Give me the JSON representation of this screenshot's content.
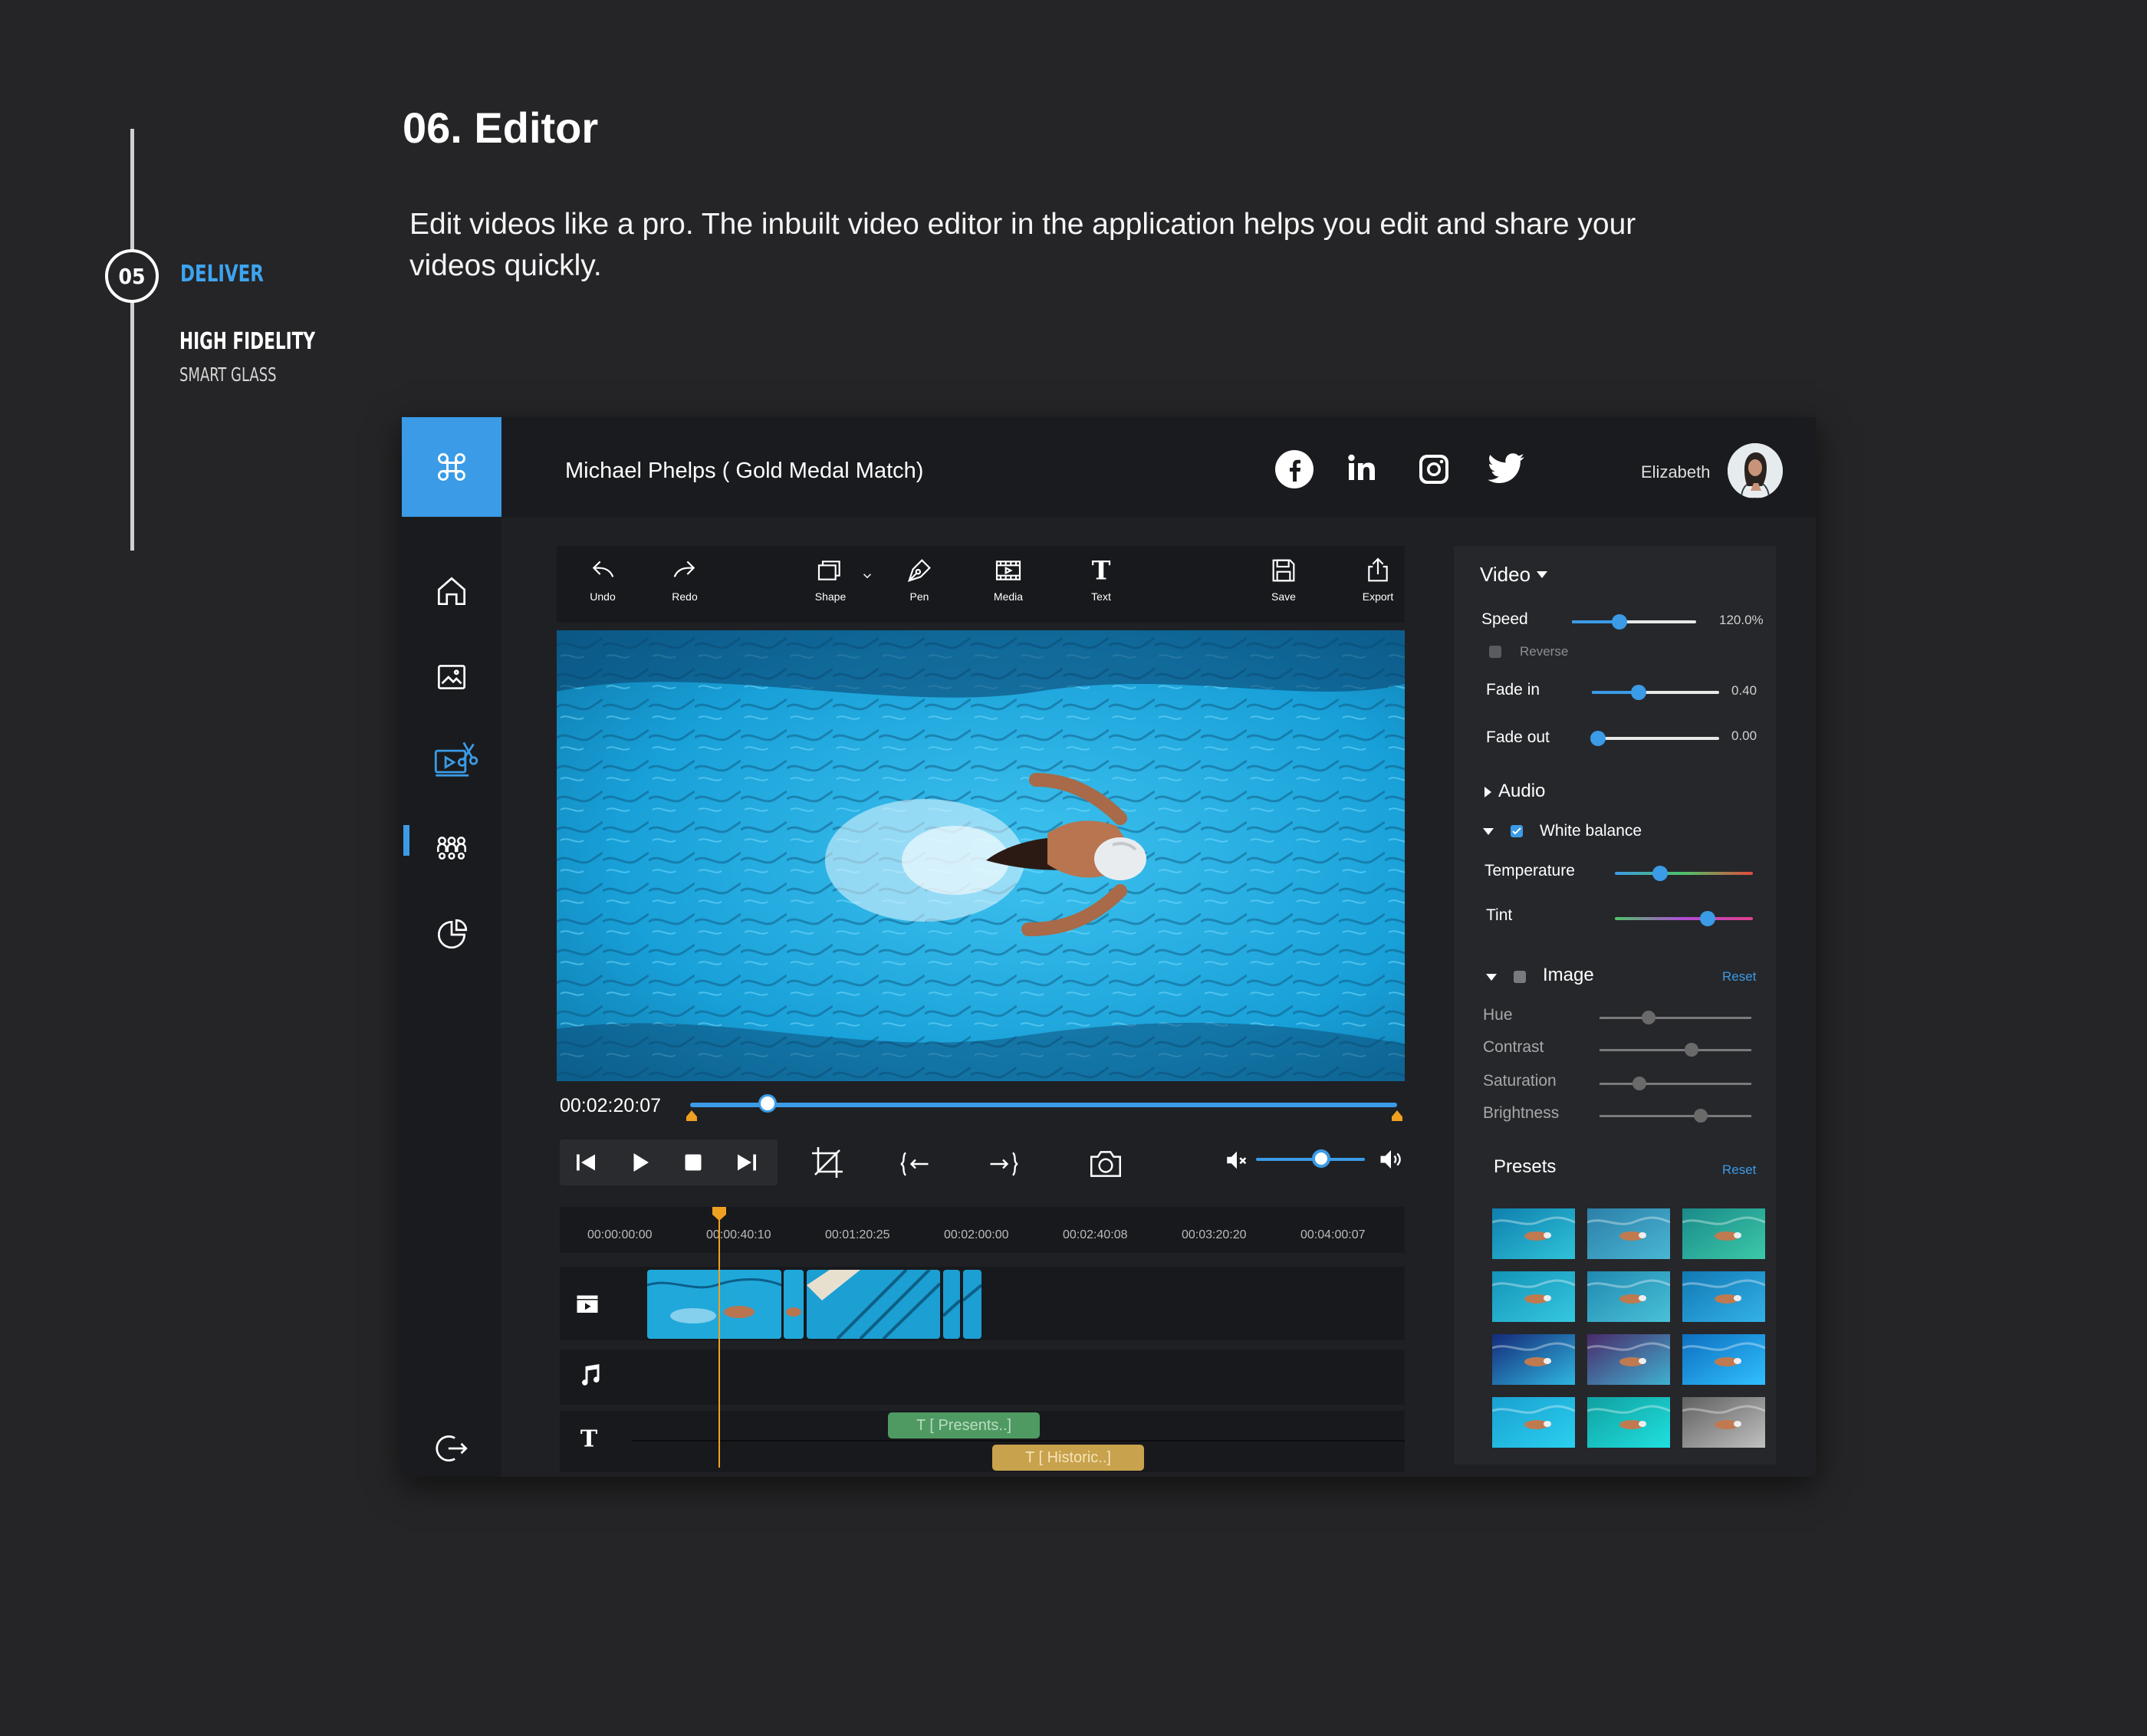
{
  "step": {
    "number": "05",
    "label": "DELIVER",
    "subtitle": "HIGH FIDELITY",
    "subsubtitle": "SMART GLASS"
  },
  "page": {
    "title": "06. Editor",
    "description": "Edit videos like a pro. The inbuilt video editor in the application helps you edit and share your videos quickly."
  },
  "app": {
    "project_title": "Michael Phelps ( Gold Medal Match)",
    "user": "Elizabeth",
    "accent": "#3b9be6",
    "social": [
      "facebook-icon",
      "linkedin-icon",
      "instagram-icon",
      "twitter-icon"
    ],
    "sidebar": [
      "home-icon",
      "gallery-icon",
      "video-edit-icon",
      "people-icon",
      "analytics-icon",
      "logout-icon"
    ],
    "active_sidebar": "video-edit-icon"
  },
  "toolbar": {
    "undo": "Undo",
    "redo": "Redo",
    "shape": "Shape",
    "pen": "Pen",
    "media": "Media",
    "text": "Text",
    "save": "Save",
    "export": "Export"
  },
  "player": {
    "timecode": "00:02:20:07",
    "progress": 0.11,
    "volume": 0.6
  },
  "timeline": {
    "ticks": [
      "00:00:00:00",
      "00:00:40:10",
      "00:01:20:25",
      "00:02:00:00",
      "00:02:40:08",
      "00:03:20:20",
      "00:04:00:07"
    ],
    "text_clip_1": "T [ Presents..]",
    "text_clip_2": "T [ Historic..]"
  },
  "panel": {
    "video_header": "Video",
    "speed_label": "Speed",
    "speed_value": "120.0%",
    "speed_level": 0.38,
    "reverse_label": "Reverse",
    "fadein_label": "Fade in",
    "fadein_value": "0.40",
    "fadein_level": 0.37,
    "fadeout_label": "Fade out",
    "fadeout_value": "0.00",
    "fadeout_level": 0.05,
    "audio_label": "Audio",
    "wb_label": "White balance",
    "temperature_label": "Temperature",
    "temperature_level": 0.33,
    "tint_label": "Tint",
    "tint_level": 0.67,
    "image_label": "Image",
    "reset_label": "Reset",
    "hue_label": "Hue",
    "hue_level": 0.33,
    "contrast_label": "Contrast",
    "contrast_level": 0.61,
    "saturation_label": "Saturation",
    "saturation_level": 0.27,
    "brightness_label": "Brightness",
    "brightness_level": 0.67,
    "presets_label": "Presets",
    "presets_reset": "Reset"
  }
}
